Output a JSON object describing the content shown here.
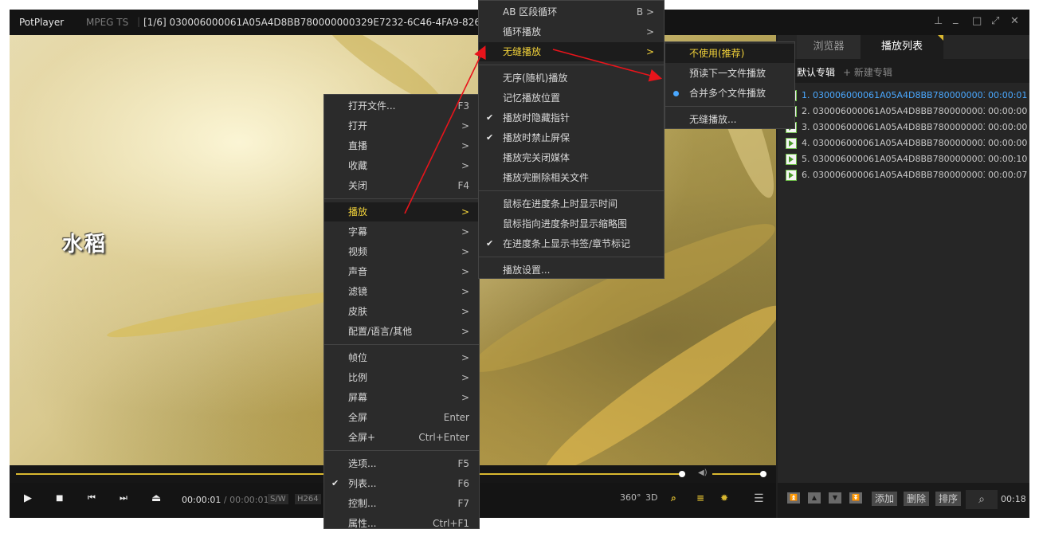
{
  "titlebar": {
    "app_name": "PotPlayer",
    "app_caret": "⌄",
    "format": "MPEG TS",
    "separator": "|",
    "file_title": "[1/6] 030006000061A05A4D8BB780000000329E7232-6C46-4FA9-826B-DB",
    "pin": "⊥",
    "minimize": "_",
    "maximize": "□",
    "fullscreen": "⤢",
    "close": "✕"
  },
  "video": {
    "caption": "水稻"
  },
  "controls": {
    "play_icon": "▶",
    "stop_icon": "■",
    "prev_icon": "⏮",
    "next_icon": "⏭",
    "eject_icon": "⏏",
    "current_time": "00:00:01",
    "time_sep": " / ",
    "total_time": "00:00:01",
    "tag_sw": "S/W",
    "tag_codec": "H264",
    "btn_360": "360°",
    "btn_3d": "3D",
    "btn_playlist": "≡",
    "btn_settings": "✹",
    "btn_menu": "☰",
    "volume_icon": "◀)"
  },
  "panel": {
    "tab_browser": "浏览器",
    "tab_playlist": "播放列表",
    "album_default": "默认专辑",
    "album_new": "+ 新建专辑",
    "items": [
      {
        "name": "1. 030006000061A05A4D8BB780000000329...",
        "duration": "00:00:01",
        "active": true
      },
      {
        "name": "2. 030006000061A05A4D8BB780000000329...",
        "duration": "00:00:00",
        "active": false
      },
      {
        "name": "3. 030006000061A05A4D8BB780000000329...",
        "duration": "00:00:00",
        "active": false
      },
      {
        "name": "4. 030006000061A05A4D8BB780000000329...",
        "duration": "00:00:00",
        "active": false
      },
      {
        "name": "5. 030006000061A05A4D8BB780000000329...",
        "duration": "00:00:10",
        "active": false
      },
      {
        "name": "6. 030006000061A05A4D8BB780000000329...",
        "duration": "00:00:07",
        "active": false
      }
    ],
    "btn_add": "添加",
    "btn_delete": "删除",
    "btn_sort": "排序",
    "search_icon": "⌕",
    "total_time": "00:18",
    "arrow_top": "⏫",
    "arrow_up": "▲",
    "arrow_down": "▼",
    "arrow_bottom": "⏬"
  },
  "main_menu": [
    {
      "label": "打开文件...",
      "key": "F3"
    },
    {
      "label": "打开",
      "key": ">"
    },
    {
      "label": "直播",
      "key": ">"
    },
    {
      "label": "收藏",
      "key": ">"
    },
    {
      "label": "关闭",
      "key": "F4"
    },
    {
      "label": "播放",
      "key": ">",
      "highlighted": true
    },
    {
      "label": "字幕",
      "key": ">"
    },
    {
      "label": "视频",
      "key": ">"
    },
    {
      "label": "声音",
      "key": ">"
    },
    {
      "label": "滤镜",
      "key": ">"
    },
    {
      "label": "皮肤",
      "key": ">"
    },
    {
      "label": "配置/语言/其他",
      "key": ">"
    },
    {
      "label": "帧位",
      "key": ">"
    },
    {
      "label": "比例",
      "key": ">"
    },
    {
      "label": "屏幕",
      "key": ">"
    },
    {
      "label": "全屏",
      "key": "Enter"
    },
    {
      "label": "全屏+",
      "key": "Ctrl+Enter"
    },
    {
      "label": "选项...",
      "key": "F5"
    },
    {
      "label": "列表...",
      "key": "F6",
      "checked": true
    },
    {
      "label": "控制...",
      "key": "F7"
    },
    {
      "label": "属性...",
      "key": "Ctrl+F1"
    }
  ],
  "play_menu": [
    {
      "label": "AB 区段循环",
      "key": "B >"
    },
    {
      "label": "循环播放",
      "key": ">"
    },
    {
      "label": "无缝播放",
      "key": ">",
      "highlighted": true
    },
    {
      "label": "无序(随机)播放",
      "key": ""
    },
    {
      "label": "记忆播放位置",
      "key": ""
    },
    {
      "label": "播放时隐藏指针",
      "key": "",
      "checked": true
    },
    {
      "label": "播放时禁止屏保",
      "key": "",
      "checked": true
    },
    {
      "label": "播放完关闭媒体",
      "key": ""
    },
    {
      "label": "播放完删除相关文件",
      "key": ""
    },
    {
      "label": "鼠标在进度条上时显示时间",
      "key": ""
    },
    {
      "label": "鼠标指向进度条时显示缩略图",
      "key": ""
    },
    {
      "label": "在进度条上显示书签/章节标记",
      "key": "",
      "checked": true
    },
    {
      "label": "播放设置...",
      "key": ""
    }
  ],
  "seamless_menu": [
    {
      "label": "不使用(推荐)",
      "highlighted": true
    },
    {
      "label": "预读下一文件播放"
    },
    {
      "label": "合并多个文件播放",
      "selected": true
    },
    {
      "label": "无缝播放..."
    }
  ],
  "check_glyph": "✔",
  "colors": {
    "accent": "#f2d23a",
    "active_link": "#4aa8ff",
    "annotation": "#e8141b"
  }
}
